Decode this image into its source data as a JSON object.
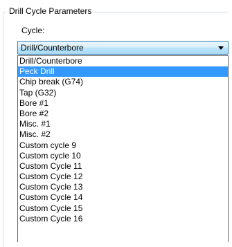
{
  "group": {
    "title": "Drill Cycle Parameters"
  },
  "cycle": {
    "label": "Cycle:",
    "value": "Drill/Counterbore",
    "options": [
      "Drill/Counterbore",
      "Peck Drill",
      "Chip break (G74)",
      "Tap (G32)",
      "Bore #1",
      "Bore #2",
      "Misc. #1",
      "Misc. #2",
      "Custom cycle 9",
      "Custom cycle 10",
      "Custom Cycle 11",
      "Custom Cycle 12",
      "Custom Cycle 13",
      "Custom Cycle 14",
      "Custom Cycle 15",
      "Custom Cycle 16"
    ],
    "highlighted_option": "Peck Drill"
  },
  "colors": {
    "highlight": "#3399ff",
    "combo_border": "#3c7fb1"
  },
  "icons": {
    "dropdown_arrow": "chevron-down-icon"
  }
}
